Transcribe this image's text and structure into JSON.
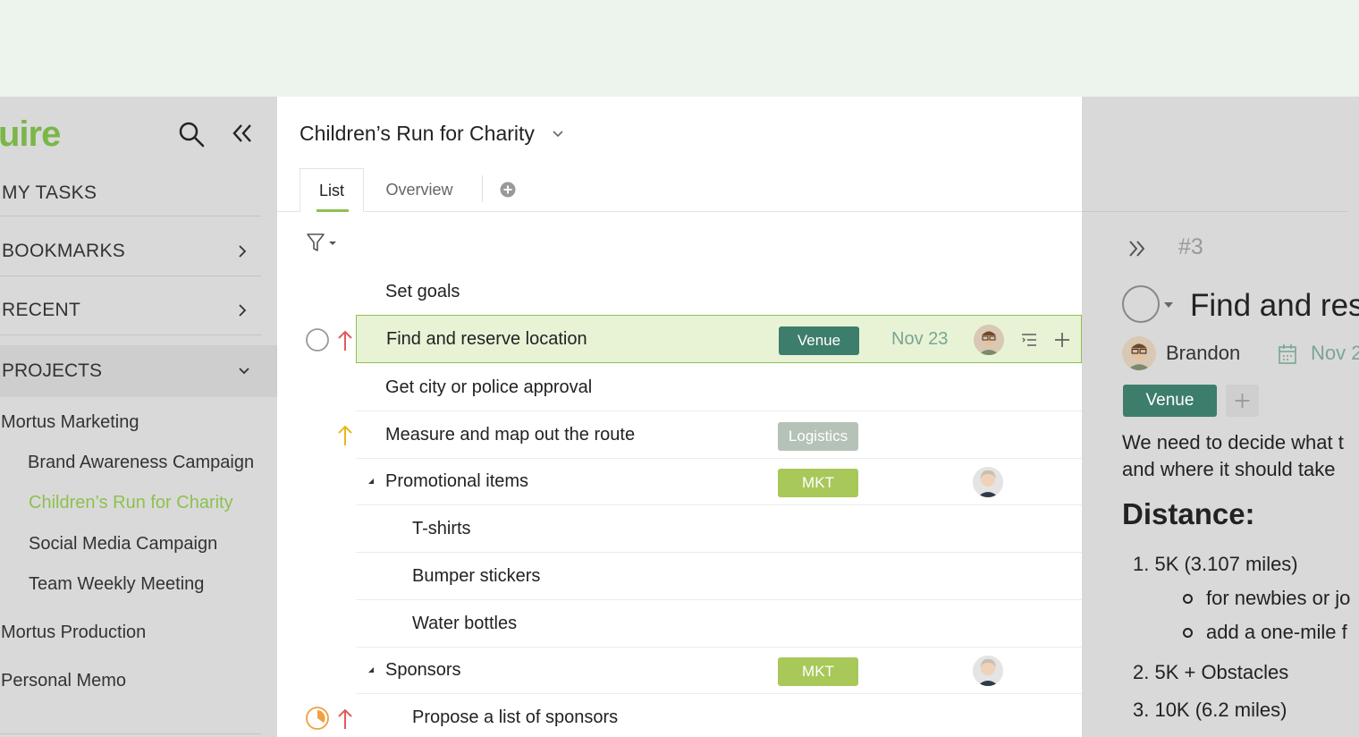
{
  "sidebar": {
    "logo": "uire",
    "sections": [
      "MY TASKS",
      "BOOKMARKS",
      "RECENT"
    ],
    "projects_label": "PROJECTS",
    "projects": [
      {
        "label": "Mortus Marketing"
      },
      {
        "label": "Brand Awareness Campaign"
      },
      {
        "label": "Children’s Run for Charity"
      },
      {
        "label": "Social Media Campaign"
      },
      {
        "label": "Team Weekly Meeting"
      },
      {
        "label": "Mortus Production"
      },
      {
        "label": "Personal Memo"
      }
    ]
  },
  "main": {
    "title": "Children’s Run for Charity",
    "tabs": [
      "List",
      "Overview"
    ],
    "tasks": [
      {
        "name": "Set goals"
      },
      {
        "name": "Find and reserve location",
        "tag": "Venue",
        "due": "Nov 23"
      },
      {
        "name": "Get city or police approval"
      },
      {
        "name": "Measure and map out the route",
        "tag": "Logistics"
      },
      {
        "name": "Promotional items",
        "tag": "MKT"
      },
      {
        "name": "T-shirts"
      },
      {
        "name": "Bumper stickers"
      },
      {
        "name": "Water bottles"
      },
      {
        "name": "Sponsors",
        "tag": "MKT"
      },
      {
        "name": "Propose a list of sponsors"
      }
    ],
    "colors": {
      "venue": "#3d7d6b",
      "logistics": "#b5c2b7",
      "mkt": "#a8c85a",
      "accent": "#8dc14f",
      "priority_high": "#e05a5a",
      "priority_medium": "#e6b820"
    }
  },
  "detail": {
    "id": "#3",
    "title": "Find and res",
    "assignee": "Brandon",
    "date": "Nov 2",
    "tag": "Venue",
    "desc_line1": "We need to decide what t",
    "desc_line2": "and where it should take",
    "heading": "Distance:",
    "items": [
      "1. 5K (3.107 miles)",
      "for newbies or jo",
      "add a one-mile f",
      "2. 5K + Obstacles",
      "3. 10K (6.2 miles)"
    ]
  }
}
